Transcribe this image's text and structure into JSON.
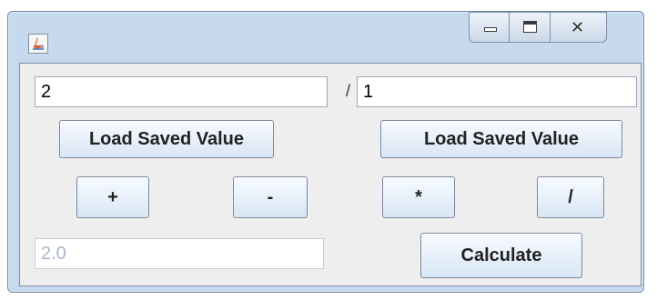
{
  "window": {
    "title": "",
    "icon": "java-cup-icon",
    "caption_buttons": [
      "minimize-icon",
      "maximize-icon",
      "close-icon"
    ]
  },
  "inputs": {
    "left_value": "2",
    "right_value": "1",
    "result_value": "2.0",
    "separator": "/"
  },
  "buttons": {
    "load_saved_left": "Load Saved Value",
    "load_saved_right": "Load Saved Value",
    "plus": "+",
    "minus": "-",
    "multiply": "*",
    "divide": "/",
    "calculate": "Calculate"
  },
  "colors": {
    "window_frame": "#c7d9ef",
    "panel_background": "#eeeeee",
    "disabled_text": "#a7b7c9"
  }
}
